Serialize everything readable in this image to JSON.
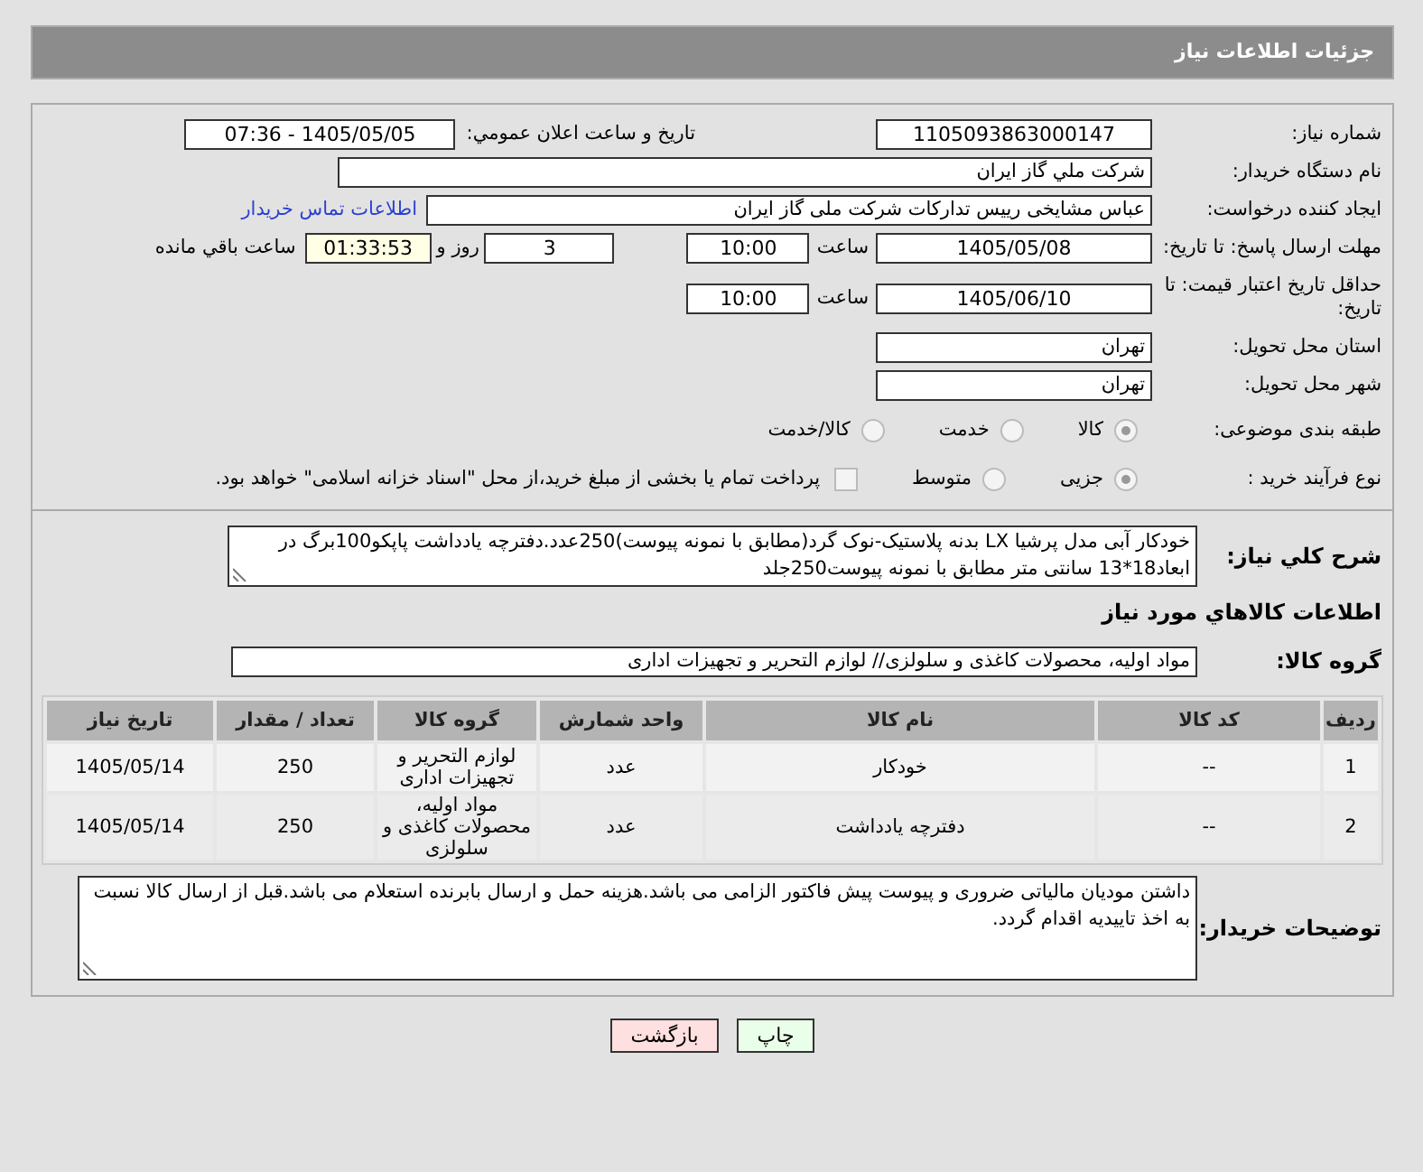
{
  "title": "جزئیات اطلاعات نیاز",
  "need_number": {
    "label": "شماره نیاز:",
    "value": "1105093863000147"
  },
  "announce": {
    "label": "تاریخ و ساعت اعلان عمومي:",
    "value": "1405/05/05 - 07:36"
  },
  "buyer_org": {
    "label": "نام دستگاه خریدار:",
    "value": "شرکت ملي گاز ايران"
  },
  "requester": {
    "label": "ایجاد کننده درخواست:",
    "value": "عباس مشایخی رییس تدارکات شرکت ملی گاز ایران",
    "link": "اطلاعات تماس خریدار"
  },
  "response_deadline": {
    "label": "مهلت ارسال پاسخ: تا تاریخ:",
    "date": "1405/05/08",
    "time_label": "ساعت",
    "time": "10:00",
    "days": "3",
    "days_label": "روز و",
    "remaining": "01:33:53",
    "remaining_label": "ساعت باقي مانده"
  },
  "price_validity": {
    "label": "حداقل تاریخ اعتبار قیمت: تا تاریخ:",
    "date": "1405/06/10",
    "time_label": "ساعت",
    "time": "10:00"
  },
  "province": {
    "label": "استان محل تحویل:",
    "value": "تهران"
  },
  "city": {
    "label": "شهر محل تحویل:",
    "value": "تهران"
  },
  "category": {
    "label": "طبقه بندی موضوعی:",
    "options": [
      {
        "label": "کالا",
        "selected": true
      },
      {
        "label": "خدمت",
        "selected": false
      },
      {
        "label": "کالا/خدمت",
        "selected": false
      }
    ]
  },
  "purchase_type": {
    "label": "نوع فرآیند خرید :",
    "options": [
      {
        "label": "جزیی",
        "selected": true
      },
      {
        "label": "متوسط",
        "selected": false
      }
    ],
    "treasury": {
      "label": "پرداخت تمام یا بخشی از مبلغ خرید،از محل \"اسناد خزانه اسلامی\" خواهد بود.",
      "checked": false
    }
  },
  "description": {
    "label": "شرح کلي نیاز:",
    "value": "خودکار آبی مدل پرشیا LX بدنه پلاستیک-نوک گرد(مطابق با نمونه پیوست)250عدد.دفترچه یادداشت پاپکو100برگ در ابعاد18*13 سانتی متر مطابق با نمونه پیوست250جلد"
  },
  "items_heading": "اطلاعات کالاهاي مورد نیاز",
  "goods_group": {
    "label": "گروه کالا:",
    "value": "مواد اولیه، محصولات کاغذی و سلولزی// لوازم التحریر و تجهیزات اداری"
  },
  "table": {
    "columns": [
      "ردیف",
      "کد کالا",
      "نام کالا",
      "واحد شمارش",
      "گروه کالا",
      "تعداد / مقدار",
      "تاریخ نیاز"
    ],
    "rows": [
      [
        "1",
        "--",
        "خودکار",
        "عدد",
        "لوازم التحریر و تجهیزات اداری",
        "250",
        "1405/05/14"
      ],
      [
        "2",
        "--",
        "دفترچه یادداشت",
        "عدد",
        "مواد اولیه، محصولات کاغذی و سلولزی",
        "250",
        "1405/05/14"
      ]
    ]
  },
  "buyer_notes": {
    "label": "توضیحات خریدار:",
    "value": "داشتن مودیان مالیاتی ضروری و پیوست پیش فاکتور الزامی می باشد.هزینه حمل و ارسال بابرنده استعلام می باشد.قبل از ارسال کالا نسبت به اخذ تاییدیه اقدام گردد."
  },
  "buttons": [
    {
      "label": "چاپ",
      "kind": "print"
    },
    {
      "label": "بازگشت",
      "kind": "back"
    }
  ]
}
